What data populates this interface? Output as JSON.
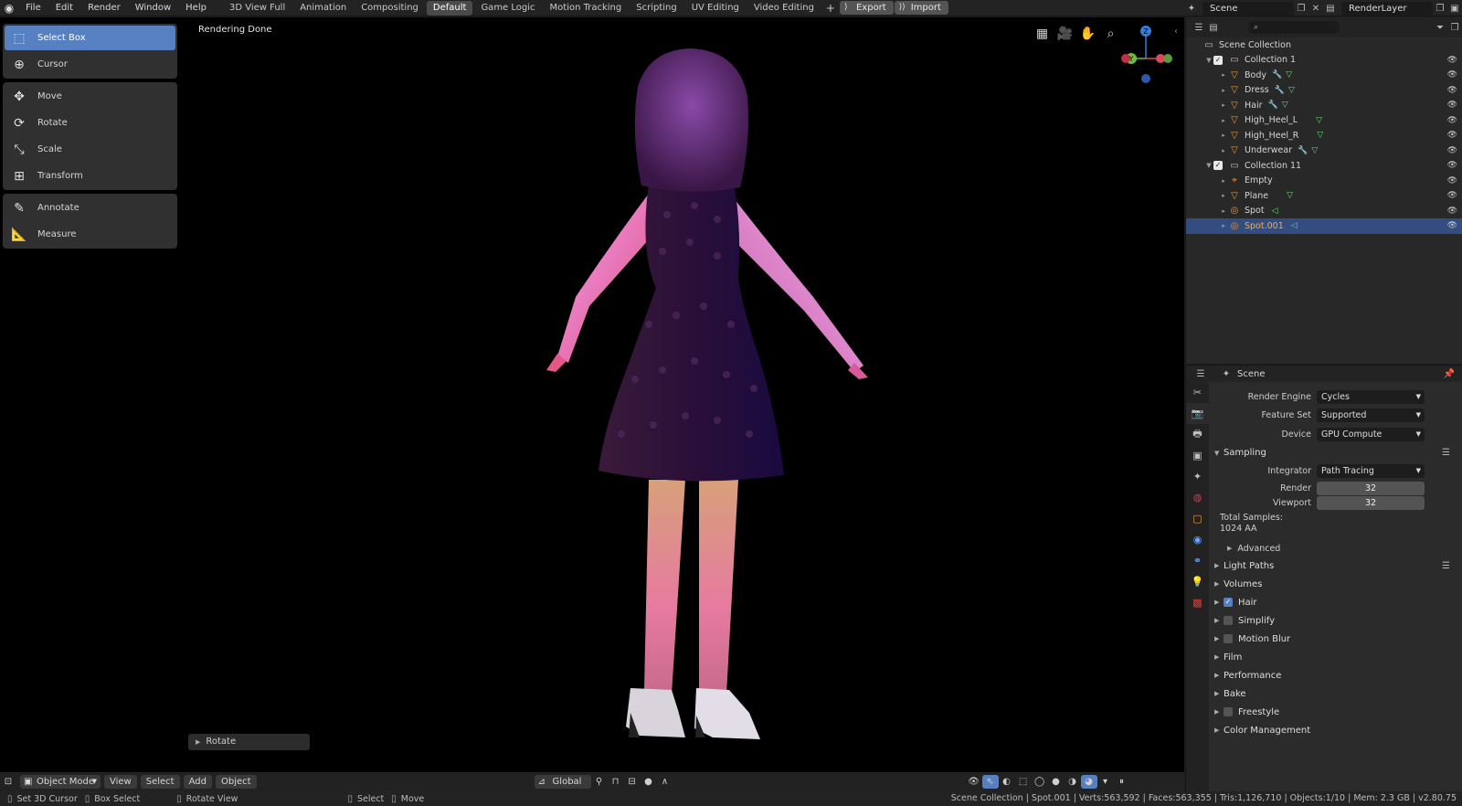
{
  "topbar": {
    "menus": [
      "File",
      "Edit",
      "Render",
      "Window",
      "Help"
    ],
    "workspaces": [
      "3D View Full",
      "Animation",
      "Compositing",
      "Default",
      "Game Logic",
      "Motion Tracking",
      "Scripting",
      "UV Editing",
      "Video Editing"
    ],
    "active_workspace": "Default",
    "export_label": "Export",
    "import_label": "Import",
    "scene_name": "Scene",
    "view_layer": "RenderLayer"
  },
  "viewport": {
    "status_text": "Rendering Done",
    "tools": [
      {
        "label": "Select Box",
        "active": true
      },
      {
        "label": "Cursor"
      },
      {
        "label": "Move"
      },
      {
        "label": "Rotate"
      },
      {
        "label": "Scale"
      },
      {
        "label": "Transform"
      },
      {
        "label": "Annotate"
      },
      {
        "label": "Measure"
      }
    ],
    "last_operator": "Rotate",
    "gizmo": {
      "z": "Z",
      "y": "Y"
    }
  },
  "vp_header": {
    "mode": "Object Mode",
    "menus": [
      "View",
      "Select",
      "Add",
      "Object"
    ],
    "orientation": "Global"
  },
  "statusbar": {
    "items": [
      "Set 3D Cursor",
      "Box Select",
      "Rotate View",
      "Select",
      "Move"
    ],
    "stats": "Scene Collection | Spot.001 | Verts:563,592 | Faces:563,355 | Tris:1,126,710 | Objects:1/10 | Mem: 2.3 GB | v2.80.75"
  },
  "outliner": {
    "root": "Scene Collection",
    "rows": [
      {
        "name": "Collection 1",
        "type": "collection",
        "level": 1
      },
      {
        "name": "Body",
        "type": "mesh",
        "level": 2,
        "modifier": true,
        "data": true
      },
      {
        "name": "Dress",
        "type": "mesh",
        "level": 2,
        "modifier": true,
        "data": true
      },
      {
        "name": "Hair",
        "type": "mesh",
        "level": 2,
        "modifier": true,
        "data": true
      },
      {
        "name": "High_Heel_L",
        "type": "mesh",
        "level": 2,
        "modifier": false,
        "data": true
      },
      {
        "name": "High_Heel_R",
        "type": "mesh",
        "level": 2,
        "modifier": false,
        "data": true
      },
      {
        "name": "Underwear",
        "type": "mesh",
        "level": 2,
        "modifier": true,
        "data": true
      },
      {
        "name": "Collection 11",
        "type": "collection",
        "level": 1
      },
      {
        "name": "Empty",
        "type": "empty",
        "level": 2
      },
      {
        "name": "Plane",
        "type": "mesh",
        "level": 2,
        "data": true
      },
      {
        "name": "Spot",
        "type": "light",
        "level": 2,
        "light": true
      },
      {
        "name": "Spot.001",
        "type": "light",
        "level": 2,
        "light": true,
        "selected": true
      }
    ]
  },
  "properties": {
    "header": "Scene",
    "render_engine_label": "Render Engine",
    "render_engine": "Cycles",
    "feature_set_label": "Feature Set",
    "feature_set": "Supported",
    "device_label": "Device",
    "device": "GPU Compute",
    "sampling": {
      "title": "Sampling",
      "integrator_label": "Integrator",
      "integrator": "Path Tracing",
      "render_label": "Render",
      "render": "32",
      "viewport_label": "Viewport",
      "viewport": "32",
      "total_label": "Total Samples:",
      "total_value": "1024 AA",
      "advanced": "Advanced"
    },
    "panels": [
      {
        "label": "Light Paths",
        "list": true
      },
      {
        "label": "Volumes"
      },
      {
        "label": "Hair",
        "checkbox": true,
        "checked": true
      },
      {
        "label": "Simplify",
        "checkbox": true,
        "checked": false
      },
      {
        "label": "Motion Blur",
        "checkbox": true,
        "checked": false
      },
      {
        "label": "Film"
      },
      {
        "label": "Performance"
      },
      {
        "label": "Bake"
      },
      {
        "label": "Freestyle",
        "checkbox": true,
        "checked": false
      },
      {
        "label": "Color Management"
      }
    ]
  },
  "colors": {
    "accent": "#5680c2",
    "selected_row": "#334d80",
    "selected_text": "#ffaf29"
  }
}
